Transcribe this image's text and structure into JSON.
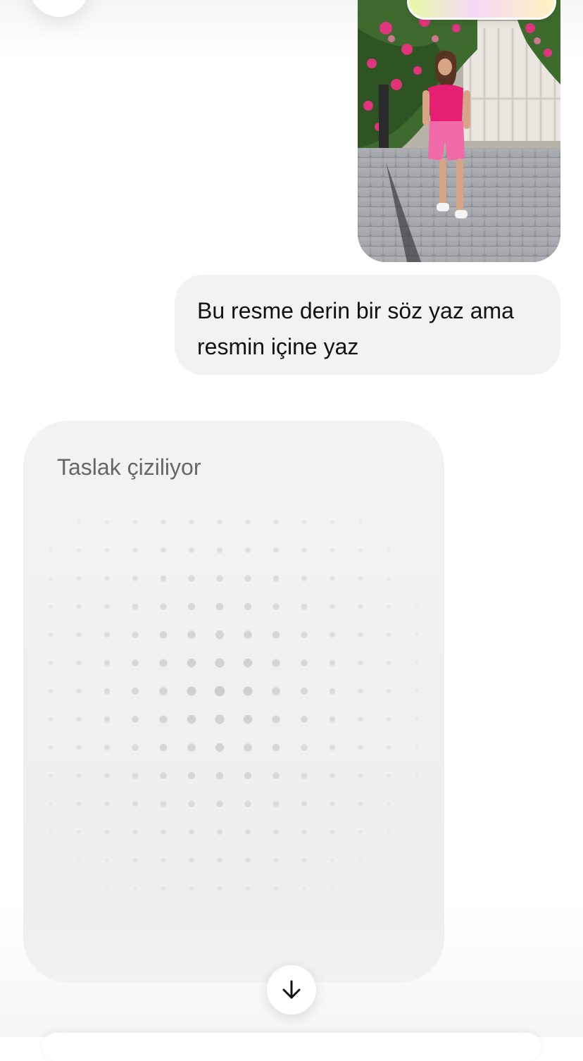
{
  "chat": {
    "user_message": "Bu resme derin bir söz yaz ama resmin içine yaz",
    "assistant_status": "Taslak çiziliyor"
  },
  "icons": {
    "back": "back-button-icon",
    "scroll_down": "arrow-down-icon"
  },
  "colors": {
    "bubble": "#f2f2f2",
    "card": "#f1f1f1",
    "status_text": "#666666"
  }
}
